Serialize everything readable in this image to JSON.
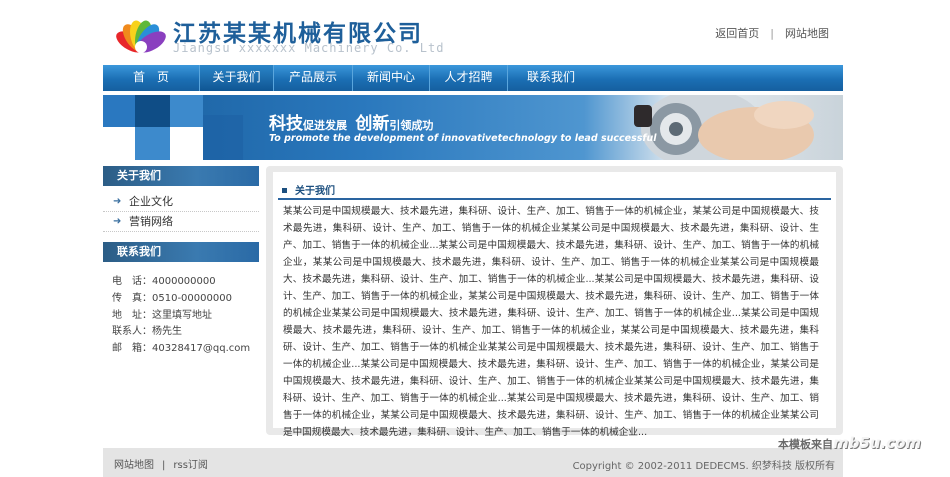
{
  "header": {
    "company_name": "江苏某某机械有限公司",
    "company_name_en": "Jiangsu xxxxxxx Machinery Co. Ltd",
    "links": [
      "返回首页",
      "网站地图"
    ]
  },
  "nav": {
    "items": [
      {
        "label": "首　页",
        "active": false
      },
      {
        "label": "关于我们",
        "active": true
      },
      {
        "label": "产品展示",
        "active": false
      },
      {
        "label": "新闻中心",
        "active": false
      },
      {
        "label": "人才招聘",
        "active": false
      },
      {
        "label": "联系我们",
        "active": false
      }
    ]
  },
  "banner": {
    "title_big_1": "科技",
    "title_small_1": "促进发展",
    "title_big_2": "创新",
    "title_small_2": "引领成功",
    "subtitle": "To promote the development of innovativetechnology to lead successful"
  },
  "sidebar": {
    "about_heading": "关于我们",
    "about_links": [
      "企业文化",
      "营销网络"
    ],
    "contact_heading": "联系我们",
    "contact_lines": [
      "电　话：4000000000",
      "传　真：0510-00000000",
      "地　址：这里填写地址",
      "联系人：杨先生",
      "邮　箱：40328417@qq.com"
    ]
  },
  "main": {
    "heading": "关于我们",
    "body": "某某公司是中国规模最大、技术最先进，集科研、设计、生产、加工、销售于一体的机械企业，某某公司是中国规模最大、技术最先进，集科研、设计、生产、加工、销售于一体的机械企业某某公司是中国规模最大、技术最先进，集科研、设计、生产、加工、销售于一体的机械企业...某某公司是中国规模最大、技术最先进，集科研、设计、生产、加工、销售于一体的机械企业，某某公司是中国规模最大、技术最先进，集科研、设计、生产、加工、销售于一体的机械企业某某公司是中国规模最大、技术最先进，集科研、设计、生产、加工、销售于一体的机械企业...某某公司是中国规模最大、技术最先进，集科研、设计、生产、加工、销售于一体的机械企业，某某公司是中国规模最大、技术最先进，集科研、设计、生产、加工、销售于一体的机械企业某某公司是中国规模最大、技术最先进，集科研、设计、生产、加工、销售于一体的机械企业...某某公司是中国规模最大、技术最先进，集科研、设计、生产、加工、销售于一体的机械企业，某某公司是中国规模最大、技术最先进，集科研、设计、生产、加工、销售于一体的机械企业某某公司是中国规模最大、技术最先进，集科研、设计、生产、加工、销售于一体的机械企业...某某公司是中国规模最大、技术最先进，集科研、设计、生产、加工、销售于一体的机械企业，某某公司是中国规模最大、技术最先进，集科研、设计、生产、加工、销售于一体的机械企业某某公司是中国规模最大、技术最先进，集科研、设计、生产、加工、销售于一体的机械企业...某某公司是中国规模最大、技术最先进，集科研、设计、生产、加工、销售于一体的机械企业，某某公司是中国规模最大、技术最先进，集科研、设计、生产、加工、销售于一体的机械企业某某公司是中国规模最大、技术最先进，集科研、设计、生产、加工、销售于一体的机械企业..."
  },
  "footer": {
    "links": [
      "网站地图",
      "rss订阅"
    ],
    "separator": "|",
    "copyright": "Copyright © 2002-2011 DEDECMS. 织梦科技 版权所有"
  },
  "watermark": {
    "cn": "本模板来自",
    "site": "mb5u.com"
  }
}
